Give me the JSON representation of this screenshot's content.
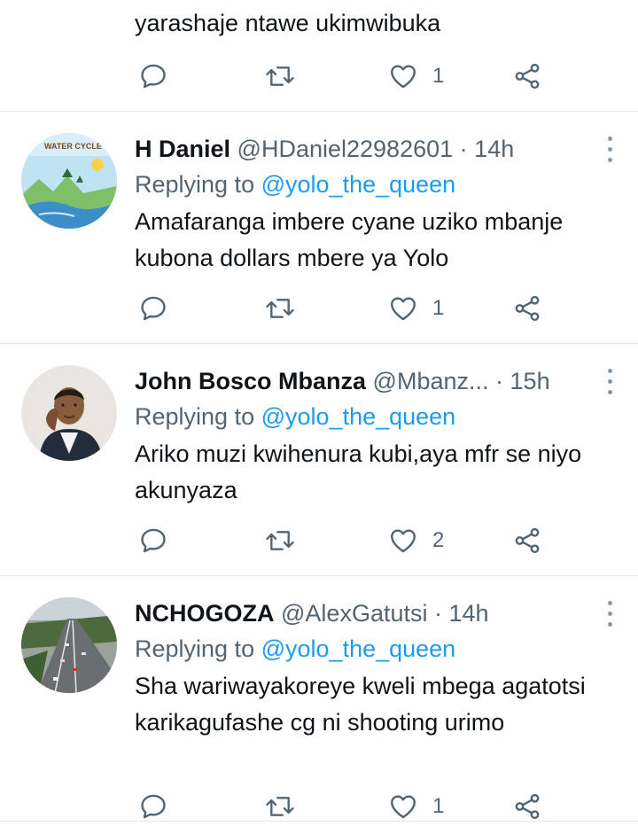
{
  "colors": {
    "accent": "#1d9bf0",
    "secondary_text": "#536471",
    "primary_text": "#0f1419",
    "divider": "#e6e6e6"
  },
  "icons": {
    "reply": "reply-icon",
    "retweet": "retweet-icon",
    "like": "heart-icon",
    "share": "share-icon",
    "more": "more-dots-icon"
  },
  "top_partial": {
    "text": "yarashaje ntawe ukimwibuka",
    "like_count": "1"
  },
  "tweets": [
    {
      "name": "H Daniel",
      "handle": "@HDaniel22982601",
      "dot": "·",
      "time": "14h",
      "replying_label": "Replying to",
      "replying_to": "@yolo_the_queen",
      "text": "Amafaranga imbere cyane uziko mbanje kubona dollars mbere ya Yolo",
      "like_count": "1",
      "avatar_text": "WATER CYCLE"
    },
    {
      "name": "John Bosco Mbanza",
      "handle": "@Mbanz...",
      "dot": "·",
      "time": "15h",
      "replying_label": "Replying to",
      "replying_to": "@yolo_the_queen",
      "text": "Ariko muzi kwihenura kubi,aya mfr se niyo akunyaza",
      "like_count": "2"
    },
    {
      "name": "NCHOGOZA",
      "handle": "@AlexGatutsi",
      "dot": "·",
      "time": "14h",
      "replying_label": "Replying to",
      "replying_to": "@yolo_the_queen",
      "text": "Sha wariwayakoreye kweli mbega agatotsi karikagufashe cg ni shooting urimo",
      "like_count": "1"
    }
  ]
}
